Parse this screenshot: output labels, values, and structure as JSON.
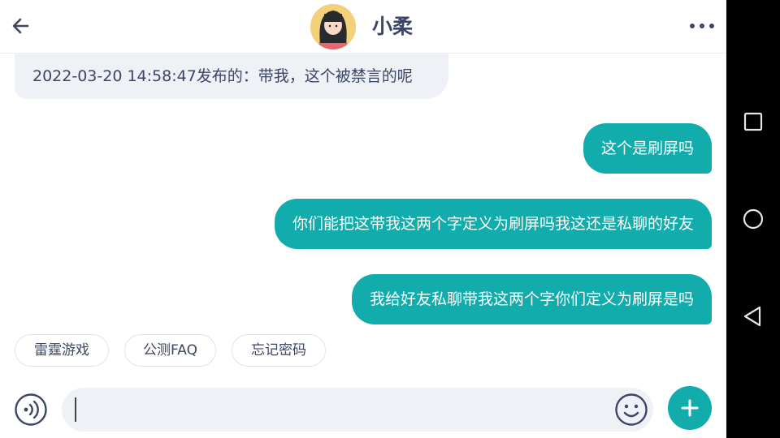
{
  "header": {
    "title": "小柔",
    "back_icon": "arrow-left-icon",
    "more_icon": "more-horizontal-icon"
  },
  "messages": [
    {
      "side": "left",
      "text": "2022-03-20 14:58:47发布的：带我，这个被禁言的呢"
    },
    {
      "side": "right",
      "text": "这个是刷屏吗"
    },
    {
      "side": "right",
      "text": "你们能把这带我这两个字定义为刷屏吗我这还是私聊的好友"
    },
    {
      "side": "right",
      "text": "我给好友私聊带我这两个字你们定义为刷屏是吗"
    }
  ],
  "quick_replies": [
    "雷霆游戏",
    "公测FAQ",
    "忘记密码"
  ],
  "input": {
    "value": "",
    "placeholder": "",
    "voice_icon": "voice-icon",
    "emoji_icon": "emoji-icon",
    "plus_icon": "plus-icon"
  },
  "navbar": {
    "recents_icon": "square-icon",
    "home_icon": "circle-icon",
    "back_icon": "triangle-back-icon"
  },
  "colors": {
    "accent": "#12acac",
    "text": "#3c4566",
    "bubble_left": "#eef1f5"
  }
}
